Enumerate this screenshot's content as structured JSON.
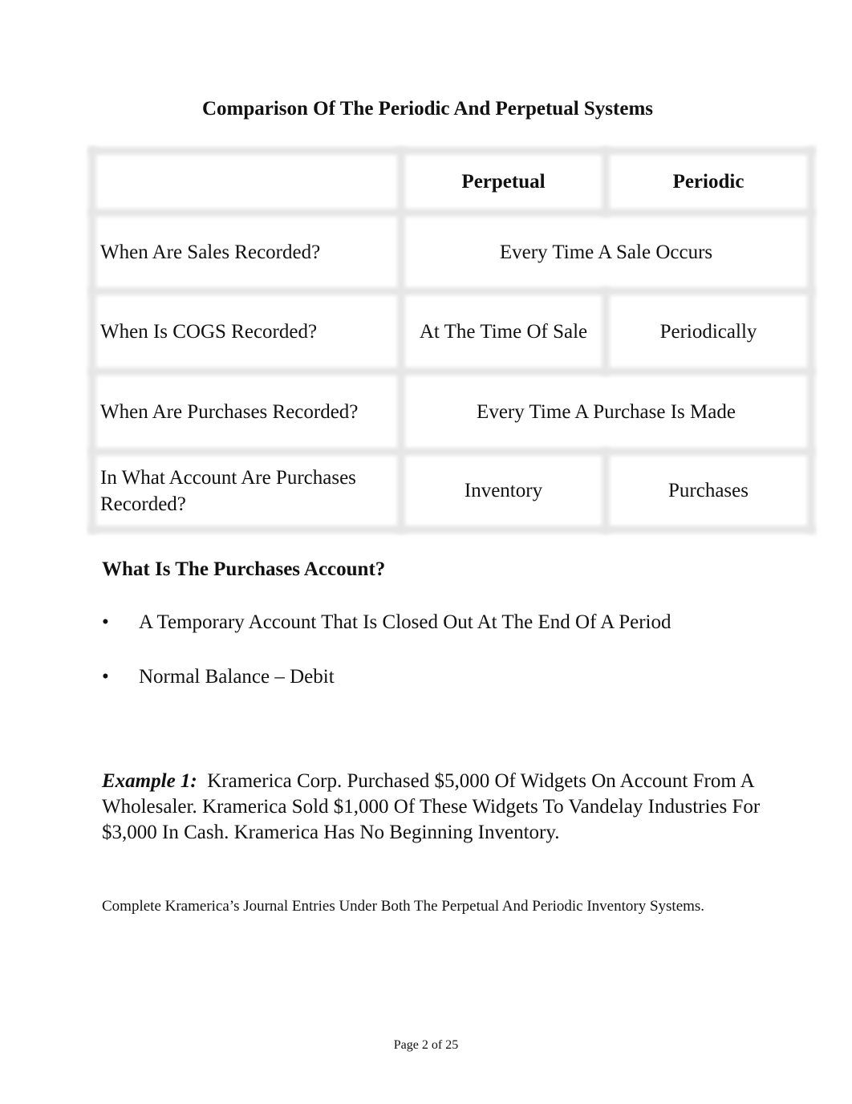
{
  "title": "Comparison Of The Periodic And Perpetual Systems",
  "table": {
    "headers": [
      "",
      "Perpetual",
      "Periodic"
    ],
    "rows": [
      {
        "question": "When Are Sales Recorded?",
        "merged": "Every Time A Sale Occurs"
      },
      {
        "question": "When Is COGS Recorded?",
        "perpetual": "At The Time Of Sale",
        "periodic": "Periodically"
      },
      {
        "question": "When Are Purchases Recorded?",
        "merged": "Every Time A Purchase Is Made"
      },
      {
        "question": "In What Account Are Purchases Recorded?",
        "perpetual": "Inventory",
        "periodic": "Purchases"
      }
    ]
  },
  "section": {
    "heading": "What Is The Purchases Account?",
    "bullet_symbol": "•",
    "bullets": [
      "A Temporary Account That Is Closed Out At The End Of A Period",
      "Normal Balance – Debit"
    ]
  },
  "example": {
    "label": "Example 1:",
    "text": "Kramerica Corp. Purchased $5,000 Of Widgets On Account From A Wholesaler.  Kramerica Sold $1,000 Of These Widgets To Vandelay Industries For $3,000 In Cash.  Kramerica Has No Beginning Inventory.",
    "instruction": "Complete Kramerica’s Journal Entries Under Both The Perpetual And Periodic Inventory Systems."
  },
  "footer": "Page 2 of 25"
}
